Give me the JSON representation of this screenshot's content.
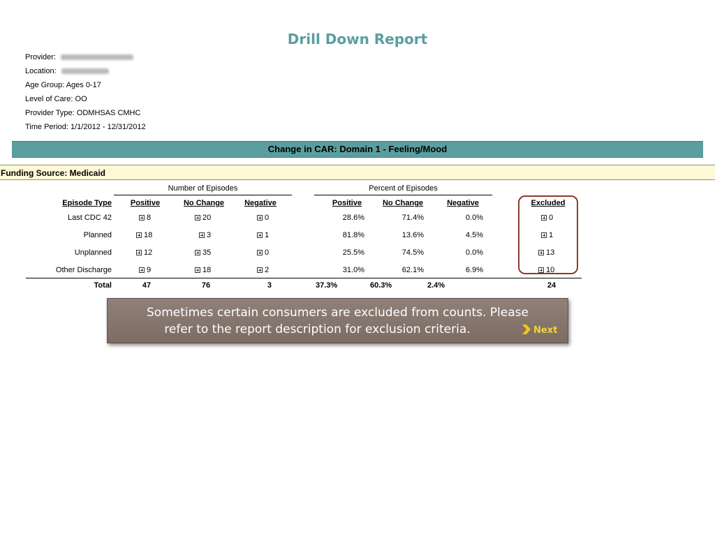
{
  "report": {
    "title": "Drill Down Report",
    "meta": {
      "provider_label": "Provider:",
      "location_label": "Location:",
      "age_group": "Age Group: Ages 0-17",
      "level_of_care": "Level of Care: OO",
      "provider_type": "Provider Type: ODMHSAS CMHC",
      "time_period": "Time Period: 1/1/2012 - 12/31/2012"
    },
    "banner": "Change in CAR: Domain 1 - Feeling/Mood",
    "funding_source": "Funding Source: Medicaid",
    "groups": {
      "number": "Number of Episodes",
      "percent": "Percent of Episodes"
    },
    "headers": {
      "episode_type": "Episode Type",
      "positive": "Positive",
      "no_change": "No Change",
      "negative": "Negative",
      "pct_positive": "Positive",
      "pct_no_change": "No Change",
      "pct_negative": "Negative",
      "excluded": "Excluded"
    },
    "rows": [
      {
        "type": "Last CDC 42",
        "pos": "8",
        "nc": "20",
        "neg": "0",
        "ppos": "28.6%",
        "pnc": "71.4%",
        "pneg": "0.0%",
        "excl": "0"
      },
      {
        "type": "Planned",
        "pos": "18",
        "nc": "3",
        "neg": "1",
        "ppos": "81.8%",
        "pnc": "13.6%",
        "pneg": "4.5%",
        "excl": "1"
      },
      {
        "type": "Unplanned",
        "pos": "12",
        "nc": "35",
        "neg": "0",
        "ppos": "25.5%",
        "pnc": "74.5%",
        "pneg": "0.0%",
        "excl": "13"
      },
      {
        "type": "Other Discharge",
        "pos": "9",
        "nc": "18",
        "neg": "2",
        "ppos": "31.0%",
        "pnc": "62.1%",
        "pneg": "6.9%",
        "excl": "10"
      }
    ],
    "total": {
      "label": "Total",
      "pos": "47",
      "nc": "76",
      "neg": "3",
      "ppos": "37.3%",
      "pnc": "60.3%",
      "pneg": "2.4%",
      "excl": "24"
    }
  },
  "callout": {
    "line1": "Sometimes certain consumers are excluded from counts.  Please",
    "line2": "refer to the report description for exclusion criteria.",
    "next_label": "Next"
  },
  "colors": {
    "teal": "#5b9ea0",
    "funding_bg": "#fdf8d6",
    "highlight_box": "#8a3c2a",
    "callout_bg": "#857570",
    "next_text": "#f2d33c"
  },
  "icons": {
    "expand": "expand-plus-icon",
    "next": "chevron-right-icon"
  }
}
